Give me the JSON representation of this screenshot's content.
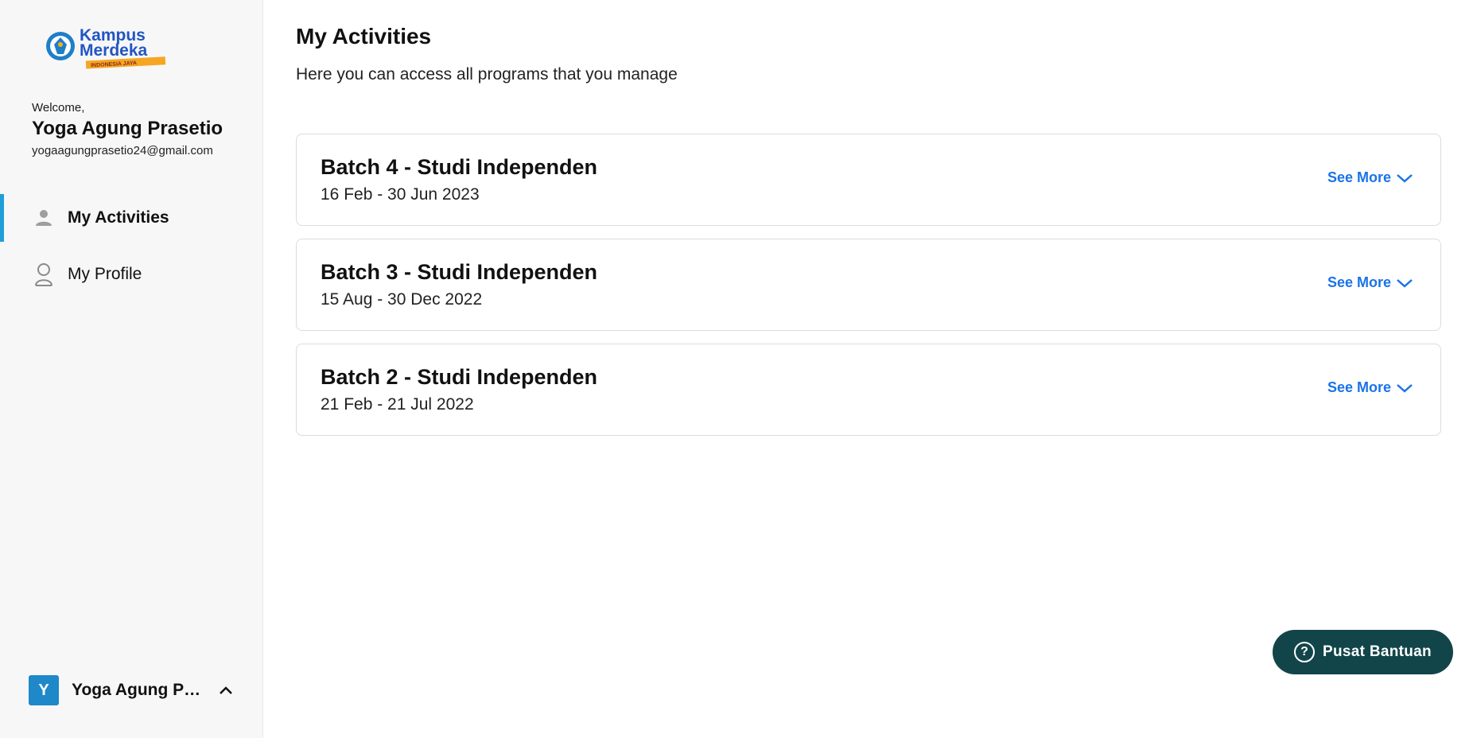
{
  "brand": {
    "logo_line1": "Kampus",
    "logo_line2": "Merdeka",
    "logo_tagline": "INDONESIA JAYA"
  },
  "sidebar": {
    "welcome": "Welcome,",
    "user_name": "Yoga Agung Prasetio",
    "user_email": "yogaagungprasetio24@gmail.com",
    "nav": [
      {
        "label": "My Activities",
        "icon": "person-filled-icon",
        "active": true
      },
      {
        "label": "My Profile",
        "icon": "person-outline-icon",
        "active": false
      }
    ],
    "account": {
      "avatar_initial": "Y",
      "name": "Yoga Agung Prasetio",
      "avatar_color": "#1e88c9"
    }
  },
  "main": {
    "title": "My Activities",
    "subtitle": "Here you can access all programs that you manage",
    "programs": [
      {
        "title": "Batch 4 - Studi Independen",
        "dates": "16 Feb - 30 Jun 2023",
        "action": "See More"
      },
      {
        "title": "Batch 3 - Studi Independen",
        "dates": "15 Aug - 30 Dec 2022",
        "action": "See More"
      },
      {
        "title": "Batch 2 - Studi Independen",
        "dates": "21 Feb - 21 Jul 2022",
        "action": "See More"
      }
    ]
  },
  "help": {
    "label": "Pusat Bantuan",
    "icon": "question-circle-icon",
    "color": "#12454a"
  },
  "colors": {
    "accent": "#1f9fd8",
    "link": "#1a73e8",
    "sidebar_bg": "#f7f7f7"
  }
}
